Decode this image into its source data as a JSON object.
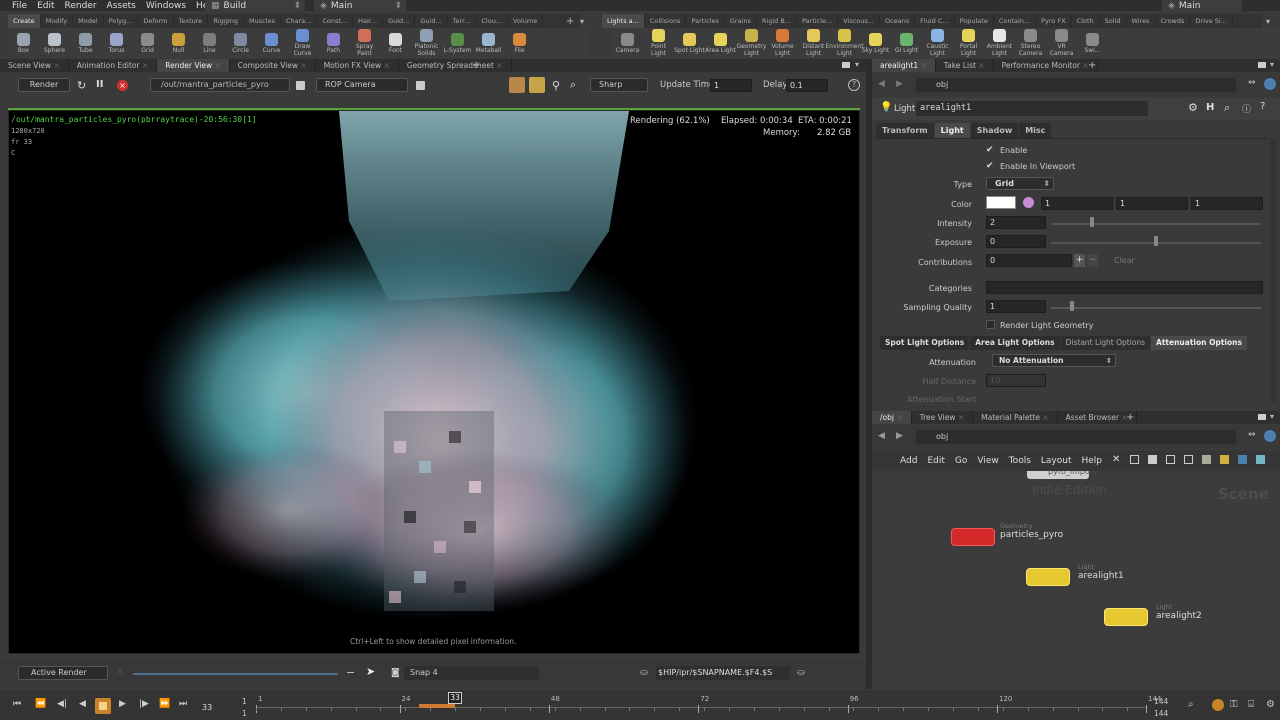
{
  "menubar": {
    "items": [
      "File",
      "Edit",
      "Render",
      "Assets",
      "Windows",
      "Help"
    ],
    "desktop_left": "Build",
    "desktop_right": "Main",
    "desktop_far_right": "Main"
  },
  "shelf_tabs_left": [
    "Create",
    "Modify",
    "Model",
    "Polyg...",
    "Deform",
    "Texture",
    "Rigging",
    "Muscles",
    "Chara...",
    "Const...",
    "Hair...",
    "Guid...",
    "Guid...",
    "Terr...",
    "Clou...",
    "Volume"
  ],
  "shelf_tabs_right": [
    "Lights a...",
    "Collisions",
    "Particles",
    "Grains",
    "Rigid B...",
    "Particle...",
    "Viscous...",
    "Oceans",
    "Fluid C...",
    "Populate",
    "Contain...",
    "Pyro FX",
    "Cloth",
    "Solid",
    "Wires",
    "Crowds",
    "Drive Si..."
  ],
  "tools_left": [
    {
      "label": "Box",
      "color": "#9aa4b0"
    },
    {
      "label": "Sphere",
      "color": "#b9c1cb"
    },
    {
      "label": "Tube",
      "color": "#8f9ba8"
    },
    {
      "label": "Torus",
      "color": "#9aa6c9"
    },
    {
      "label": "Grid",
      "color": "#8b8b8b"
    },
    {
      "label": "Null",
      "color": "#c9a03a"
    },
    {
      "label": "Line",
      "color": "#7d7d7d"
    },
    {
      "label": "Circle",
      "color": "#7f8aa0"
    },
    {
      "label": "Curve",
      "color": "#6a8ecf"
    },
    {
      "label": "Draw Curve",
      "color": "#6a8ecf"
    },
    {
      "label": "Path",
      "color": "#8a7ccf"
    },
    {
      "label": "Spray Paint",
      "color": "#cf6f5a"
    },
    {
      "label": "Font",
      "color": "#d9d9d9"
    },
    {
      "label": "Platonic Solids",
      "color": "#8fa0b5"
    },
    {
      "label": "L-System",
      "color": "#5a8f4a"
    },
    {
      "label": "Metaball",
      "color": "#9ab5d0"
    },
    {
      "label": "File",
      "color": "#d98a3a"
    }
  ],
  "tools_right": [
    {
      "label": "Camera",
      "color": "#8a8a8a"
    },
    {
      "label": "Point Light",
      "color": "#e6d35a"
    },
    {
      "label": "Spot Light",
      "color": "#e6c85a"
    },
    {
      "label": "Area Light",
      "color": "#e6d35a"
    },
    {
      "label": "Geometry Light",
      "color": "#c9b24a"
    },
    {
      "label": "Volume Light",
      "color": "#d97a3a"
    },
    {
      "label": "Distant Light",
      "color": "#e6c85a"
    },
    {
      "label": "Environment Light",
      "color": "#d9c24a"
    },
    {
      "label": "Sky Light",
      "color": "#e6d35a"
    },
    {
      "label": "GI Light",
      "color": "#6ab56a"
    },
    {
      "label": "Caustic Light",
      "color": "#8ab5e6"
    },
    {
      "label": "Portal Light",
      "color": "#e6d35a"
    },
    {
      "label": "Ambient Light",
      "color": "#e6e6e6"
    },
    {
      "label": "Stereo Camera",
      "color": "#8a8a8a"
    },
    {
      "label": "VR Camera",
      "color": "#8a8a8a"
    },
    {
      "label": "Swi...",
      "color": "#8a8a8a"
    }
  ],
  "left_pane_tabs": [
    "Scene View",
    "Animation Editor",
    "Render View",
    "Composite View",
    "Motion FX View",
    "Geometry Spreadsheet"
  ],
  "render_toolbar": {
    "render_label": "Render",
    "rop_path": "/out/mantra_particles_pyro",
    "camera": "ROP Camera",
    "quality": "Sharp",
    "update_time_label": "Update Time",
    "update_time_value": "1",
    "delay_label": "Delay",
    "delay_value": "0.1"
  },
  "viewport": {
    "info_line1": "/out/mantra_particles_pyro(pbrraytrace)-20:56:30[1]",
    "info_line2": "1280x720",
    "info_line3": "fr 33",
    "info_line4": "C",
    "rendering": "Rendering (62.1%)",
    "elapsed": "Elapsed: 0:00:34",
    "eta": "ETA: 0:00:21",
    "memory_label": "Memory:",
    "memory_value": "2.82 GB",
    "hint": "Ctrl+Left to show detailed pixel information."
  },
  "render_bottom": {
    "active_render": "Active Render",
    "snap": "Snap 4",
    "path": "$HIP/ipr/$SNAPNAME.$F4.$S"
  },
  "right_tabs": [
    "arealight1",
    "Take List",
    "Performance Monitor"
  ],
  "right_path": "obj",
  "param_header": {
    "type": "Light",
    "name": "arealight1"
  },
  "param_tabs": [
    "Transform",
    "Light",
    "Shadow",
    "Misc"
  ],
  "params": {
    "enable": "Enable",
    "enable_viewport": "Enable In Viewport",
    "type_label": "Type",
    "type_value": "Grid",
    "color_label": "Color",
    "color_r": "1",
    "color_g": "1",
    "color_b": "1",
    "intensity_label": "Intensity",
    "intensity_value": "2",
    "exposure_label": "Exposure",
    "exposure_value": "0",
    "contrib_label": "Contributions",
    "contrib_value": "0",
    "clear": "Clear",
    "categories_label": "Categories",
    "sampling_label": "Sampling Quality",
    "sampling_value": "1",
    "render_geo": "Render Light Geometry"
  },
  "option_tabs": [
    "Spot Light Options",
    "Area Light Options",
    "Distant Light Options",
    "Attenuation Options"
  ],
  "attenuation": {
    "label": "Attenuation",
    "value": "No Attenuation",
    "half_distance": "Half Distance",
    "half_value": "10",
    "atten_start": "Attenuation Start"
  },
  "network_tabs": [
    "/obj",
    "Tree View",
    "Material Palette",
    "Asset Browser"
  ],
  "network_path": "obj",
  "network_menu": [
    "Add",
    "Edit",
    "Go",
    "View",
    "Tools",
    "Layout",
    "Help"
  ],
  "network": {
    "watermark1": "Indie Edition",
    "watermark2": "Scene",
    "partial_node": "pyro_import",
    "node1_type": "Geometry",
    "node1_name": "particles_pyro",
    "node2_type": "Light",
    "node2_name": "arealight1",
    "node3_type": "Light",
    "node3_name": "arealight2"
  },
  "timeline": {
    "frame": "33",
    "start": "1",
    "start2": "1",
    "end": "144",
    "end2": "144",
    "ticks": [
      {
        "v": "1",
        "f": 0
      },
      {
        "v": "24",
        "f": 0.1613
      },
      {
        "v": "48",
        "f": 0.3291
      },
      {
        "v": "72",
        "f": 0.497
      },
      {
        "v": "96",
        "f": 0.6648
      },
      {
        "v": "120",
        "f": 0.8326
      },
      {
        "v": "144",
        "f": 1
      }
    ],
    "current_fraction": 0.2238
  }
}
